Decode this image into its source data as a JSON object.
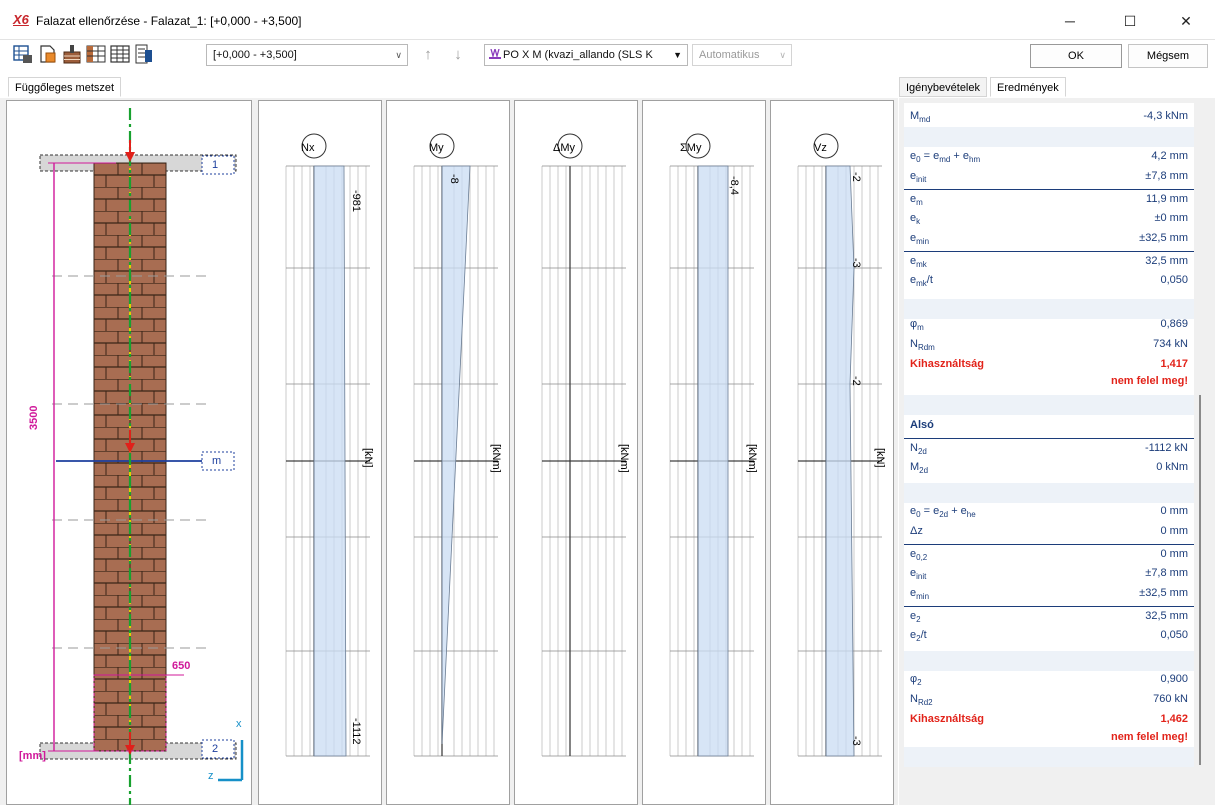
{
  "window": {
    "logo": "X6",
    "title": "Falazat ellenőrzése - Falazat_1: [+0,000 - +3,500]",
    "minimize": "─",
    "maximize": "☐",
    "close": "✕"
  },
  "toolbar": {
    "range_value": "[+0,000 - +3,500]",
    "load_combo_value": "PO X M (kvazi_allando (SLS K",
    "mode_value": "Automatikus",
    "ok_label": "OK",
    "cancel_label": "Mégsem",
    "icons": [
      "table-export-icon",
      "document-copy-icon",
      "wall-settings-icon",
      "brick-grid-icon",
      "table-grid-icon",
      "report-icon"
    ]
  },
  "section": {
    "tab_label": "Függőleges metszet",
    "section_labels": [
      "1",
      "m",
      "2"
    ],
    "height_dim": "3500",
    "width_dim": "650",
    "unit": "[mm]",
    "axis_x": "x",
    "axis_z": "z"
  },
  "diagrams": [
    {
      "name": "Nx",
      "unit": "[kN]",
      "top_value": "-981",
      "bottom_value": "-1112",
      "mid_value": ""
    },
    {
      "name": "My",
      "unit": "[kNm]",
      "top_value": "-8",
      "bottom_value": "",
      "mid_value": ""
    },
    {
      "name": "ΔMy",
      "unit": "[kNm]",
      "top_value": "",
      "bottom_value": "",
      "mid_value": ""
    },
    {
      "name": "ΣMy",
      "unit": "[kNm]",
      "top_value": "-8,4",
      "bottom_value": "",
      "mid_value": ""
    },
    {
      "name": "Vz",
      "unit": "[kN]",
      "top_value": "-2",
      "bottom_value": "-3",
      "mid_value": "-3",
      "mid2_value": "-2"
    }
  ],
  "results": {
    "tab_loads": "Igénybevételek",
    "tab_results": "Eredmények",
    "top": {
      "m_md_label": "M",
      "m_md_sub": "md",
      "m_md_value": "-4,3 kNm",
      "e0_formula": "e₀ = e_md + e_hm",
      "e0_value": "4,2 mm",
      "einit_value": "±7,8 mm",
      "em_value": "11,9 mm",
      "ek_value": "±0 mm",
      "emin_value": "±32,5 mm",
      "emk_value": "32,5 mm",
      "emk_t_value": "0,050",
      "phi_m_value": "0,869",
      "nrdm_value": "734 kN",
      "utilization_label": "Kihasználtság",
      "utilization_value": "1,417",
      "verdict": "nem felel meg!"
    },
    "bottom": {
      "header": "Alsó",
      "n2d_value": "-1112 kN",
      "m2d_value": "0 kNm",
      "e0_value": "0 mm",
      "dz_label": "Δz",
      "dz_value": "0 mm",
      "e02_value": "0 mm",
      "einit_value": "±7,8 mm",
      "emin_value": "±32,5 mm",
      "e2_value": "32,5 mm",
      "e2_t_value": "0,050",
      "phi2_value": "0,900",
      "nrd2_value": "760 kN",
      "utilization_label": "Kihasználtság",
      "utilization_value": "1,462",
      "verdict": "nem felel meg!"
    }
  }
}
